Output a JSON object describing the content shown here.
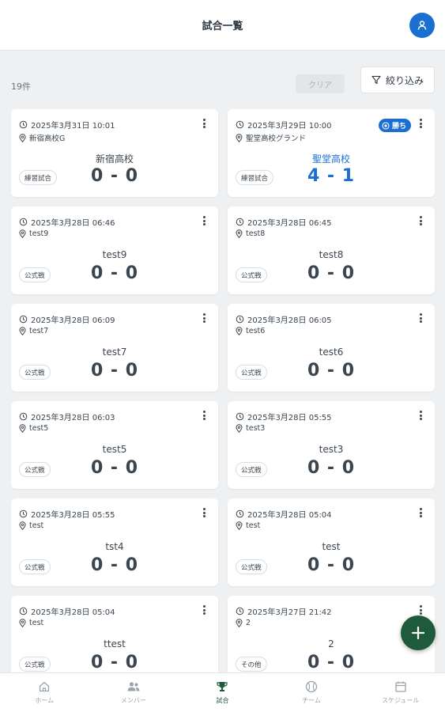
{
  "header": {
    "title": "試合一覧",
    "avatar_icon": "user-icon"
  },
  "toolbar": {
    "count": "19件",
    "clear_label": "クリア",
    "filter_label": "絞り込み"
  },
  "colors": {
    "accent_blue": "#1a6fd1",
    "brand_green": "#1f5a3c",
    "background": "#eef0f2"
  },
  "matches": [
    {
      "datetime": "2025年3月31日 10:01",
      "location": "新宿高校G",
      "opponent": "新宿高校",
      "score": "0 - 0",
      "type": "練習試合",
      "result": ""
    },
    {
      "datetime": "2025年3月29日 10:00",
      "location": "聖堂高校グランド",
      "opponent": "聖堂高校",
      "score": "4 - 1",
      "type": "練習試合",
      "result": "勝ち"
    },
    {
      "datetime": "2025年3月28日 06:46",
      "location": "test9",
      "opponent": "test9",
      "score": "0 - 0",
      "type": "公式戦",
      "result": ""
    },
    {
      "datetime": "2025年3月28日 06:45",
      "location": "test8",
      "opponent": "test8",
      "score": "0 - 0",
      "type": "公式戦",
      "result": ""
    },
    {
      "datetime": "2025年3月28日 06:09",
      "location": "test7",
      "opponent": "test7",
      "score": "0 - 0",
      "type": "公式戦",
      "result": ""
    },
    {
      "datetime": "2025年3月28日 06:05",
      "location": "test6",
      "opponent": "test6",
      "score": "0 - 0",
      "type": "公式戦",
      "result": ""
    },
    {
      "datetime": "2025年3月28日 06:03",
      "location": "test5",
      "opponent": "test5",
      "score": "0 - 0",
      "type": "公式戦",
      "result": ""
    },
    {
      "datetime": "2025年3月28日 05:55",
      "location": "test3",
      "opponent": "test3",
      "score": "0 - 0",
      "type": "公式戦",
      "result": ""
    },
    {
      "datetime": "2025年3月28日 05:55",
      "location": "test",
      "opponent": "tst4",
      "score": "0 - 0",
      "type": "公式戦",
      "result": ""
    },
    {
      "datetime": "2025年3月28日 05:04",
      "location": "test",
      "opponent": "test",
      "score": "0 - 0",
      "type": "公式戦",
      "result": ""
    },
    {
      "datetime": "2025年3月28日 05:04",
      "location": "test",
      "opponent": "ttest",
      "score": "0 - 0",
      "type": "公式戦",
      "result": ""
    },
    {
      "datetime": "2025年3月27日 21:42",
      "location": "2",
      "opponent": "2",
      "score": "0 - 0",
      "type": "その他",
      "result": ""
    }
  ],
  "nav": [
    {
      "label": "ホーム",
      "icon": "home-icon",
      "active": false
    },
    {
      "label": "メンバー",
      "icon": "members-icon",
      "active": false
    },
    {
      "label": "試合",
      "icon": "trophy-icon",
      "active": true
    },
    {
      "label": "チーム",
      "icon": "baseball-icon",
      "active": false
    },
    {
      "label": "スケジュール",
      "icon": "calendar-icon",
      "active": false
    }
  ],
  "fab": {
    "icon": "plus-icon"
  }
}
